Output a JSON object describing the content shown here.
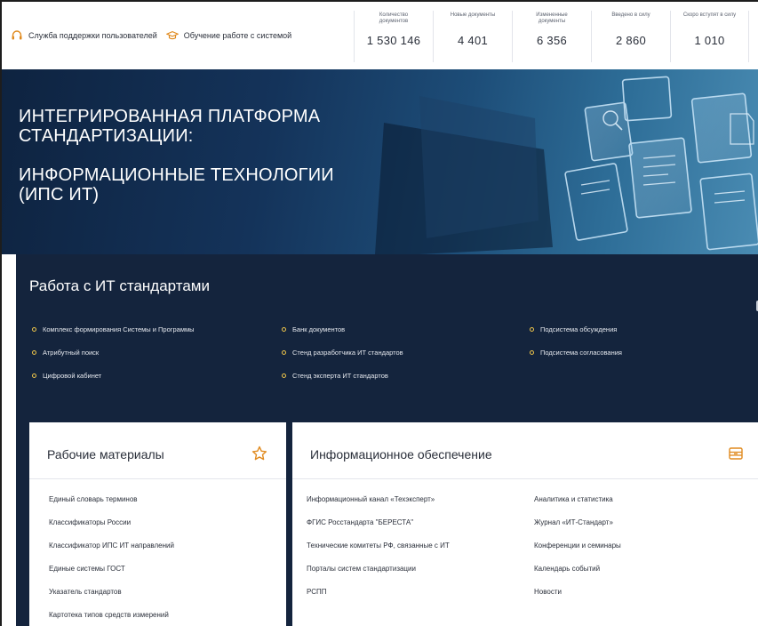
{
  "header": {
    "support_label": "Служба поддержки пользователей",
    "training_label": "Обучение работе с системой",
    "support_icon": "headset-icon",
    "training_icon": "graduation-cap-icon"
  },
  "stats": [
    {
      "label": "Количество документов",
      "value": "1 530 146"
    },
    {
      "label": "Новые документы",
      "value": "4 401"
    },
    {
      "label": "Измененные документы",
      "value": "6 356"
    },
    {
      "label": "Введено в силу",
      "value": "2 860"
    },
    {
      "label": "Скоро вступят в силу",
      "value": "1 010"
    }
  ],
  "hero": {
    "line1": "ИНТЕГРИРОВАННАЯ ПЛАТФОРМА",
    "line2": "СТАНДАРТИЗАЦИИ:",
    "line3": "ИНФОРМАЦИОННЫЕ ТЕХНОЛОГИИ",
    "line4": "(ИПС ИТ)"
  },
  "works": {
    "title": "Работа с ИТ стандартами",
    "links": [
      "Комплекс формирования Системы и Программы",
      "Атрибутный поиск",
      "Цифровой кабинет",
      "Банк документов",
      "Стенд разработчика ИТ стандартов",
      "Стенд эксперта ИТ стандартов",
      "Подсистема обсуждения",
      "Подсистема согласования"
    ]
  },
  "materials": {
    "title": "Рабочие материалы",
    "icon": "star-icon",
    "items": [
      "Единый словарь терминов",
      "Классификаторы России",
      "Классификатор ИПС ИТ направлений",
      "Единые системы ГОСТ",
      "Указатель стандартов",
      "Картотека типов средств измерений"
    ]
  },
  "info": {
    "title": "Информационное обеспечение",
    "icon": "archive-box-icon",
    "col1": [
      "Информационный канал «Техэксперт»",
      "ФГИС Росстандарта \"БЕРЕСТА\"",
      "Технические комитеты РФ, связанные с ИТ",
      "Порталы систем стандартизации",
      "РСПП"
    ],
    "col2": [
      "Аналитика и статистика",
      "Журнал «ИТ-Стандарт»",
      "Конференции и семинары",
      "Календарь событий",
      "Новости"
    ]
  },
  "colors": {
    "navy": "#14243d",
    "accent": "#f0c64a",
    "icon_orange": "#e08a1e"
  }
}
